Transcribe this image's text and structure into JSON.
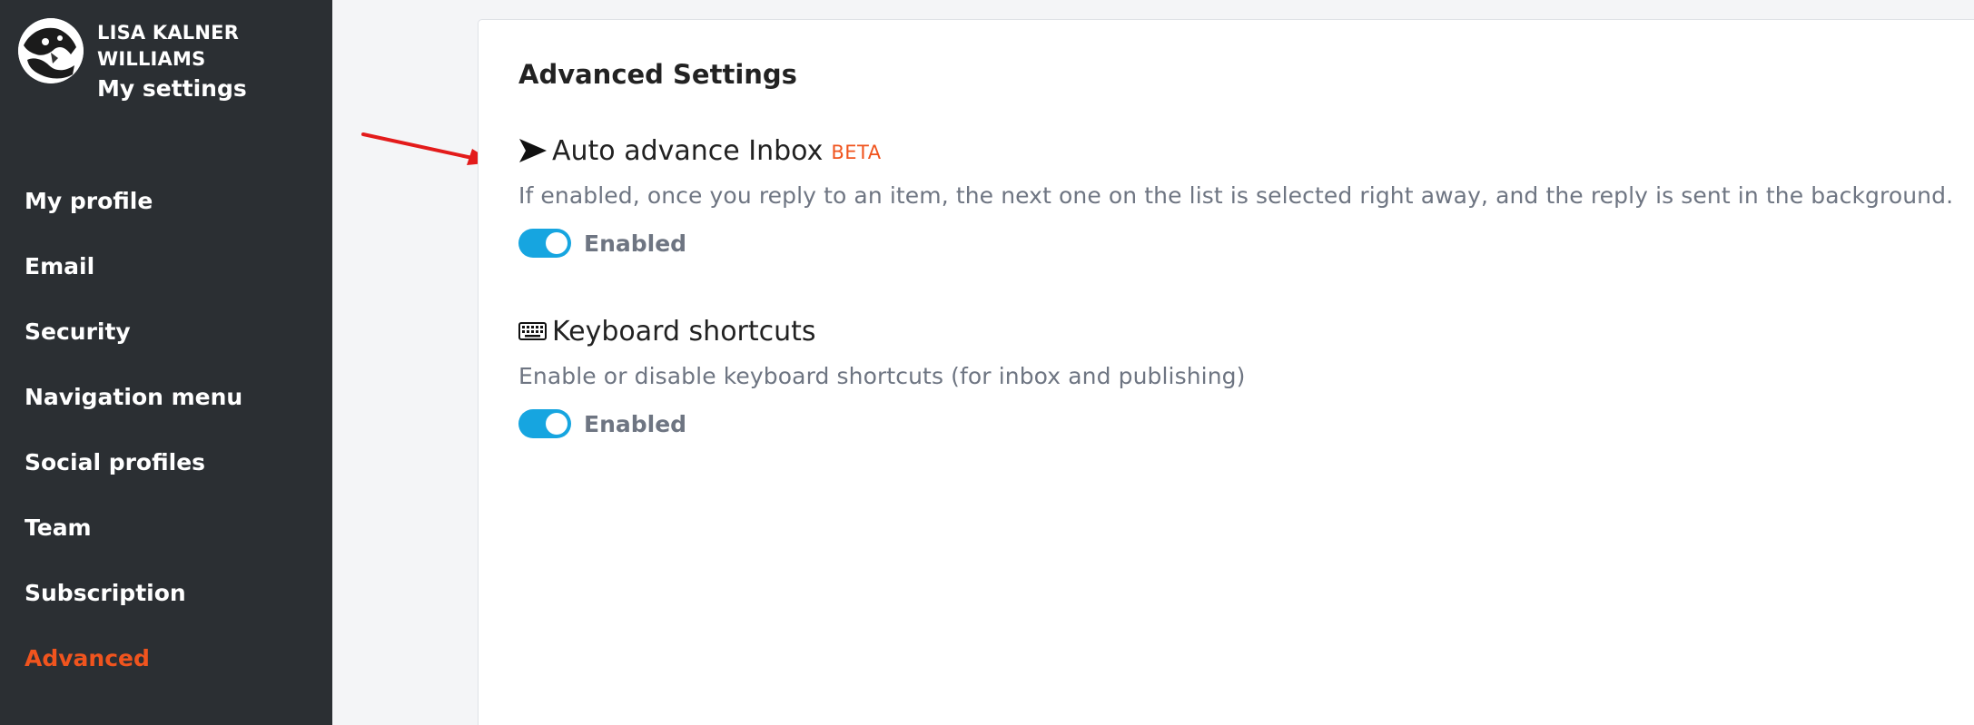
{
  "user": {
    "name": "LISA KALNER WILLIAMS",
    "subtitle": "My settings"
  },
  "sidebar": {
    "items": [
      {
        "label": "My profile",
        "active": false
      },
      {
        "label": "Email",
        "active": false
      },
      {
        "label": "Security",
        "active": false
      },
      {
        "label": "Navigation menu",
        "active": false
      },
      {
        "label": "Social profiles",
        "active": false
      },
      {
        "label": "Team",
        "active": false
      },
      {
        "label": "Subscription",
        "active": false
      },
      {
        "label": "Advanced",
        "active": true
      }
    ]
  },
  "main": {
    "title": "Advanced Settings",
    "settings": [
      {
        "icon": "send-icon",
        "title": "Auto advance Inbox",
        "badge": "BETA",
        "description": "If enabled, once you reply to an item, the next one on the list is selected right away, and the reply is sent in the background.",
        "toggle_on": true,
        "toggle_label": "Enabled"
      },
      {
        "icon": "keyboard-icon",
        "title": "Keyboard shortcuts",
        "description": "Enable or disable keyboard shortcuts (for inbox and publishing)",
        "toggle_on": true,
        "toggle_label": "Enabled"
      }
    ]
  },
  "colors": {
    "sidebar_bg": "#2b2f33",
    "accent": "#f0541e",
    "toggle_on": "#16a5e0",
    "annotation_arrow": "#e31b1b"
  }
}
